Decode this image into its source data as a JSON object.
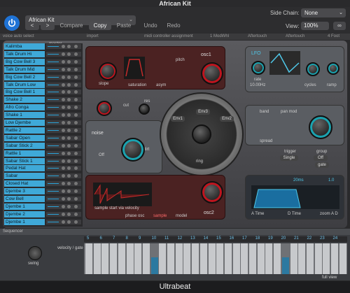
{
  "window": {
    "title": "African Kit",
    "footer": "Ultrabeat"
  },
  "header": {
    "preset": "African Kit",
    "compare": "Compare",
    "copy": "Copy",
    "paste": "Paste",
    "undo": "Undo",
    "redo": "Redo",
    "side_chain_label": "Side Chain:",
    "side_chain_value": "None",
    "view_label": "View:",
    "view_value": "100%",
    "prev": "<",
    "next": ">"
  },
  "control_strip": {
    "voice_auto_select": "voice auto select",
    "import": "import",
    "midi_controller": "midi controller assignment",
    "ctrl_a": "1 ModWhl",
    "ctrl_b": "Aftertouch",
    "ctrl_c": "Aftertouch",
    "ctrl_d": "4 Foot"
  },
  "drums": {
    "master": "master",
    "items": [
      "Kalimba",
      "Talk Drum Hi",
      "Big Cow Bell 3",
      "Talk Drum Mid",
      "Big Cow Bell 2",
      "Talk Drum Low",
      "Big Cow Bell 1",
      "Shake 2",
      "Afro Conga",
      "Shake 1",
      "Low Djembe",
      "Rattle 2",
      "Sabar Open",
      "Sabar Stick 2",
      "Rattle 1",
      "Sabar Stick 1",
      "Pedal Hat",
      "Sabar",
      "Closed Hat",
      "Djembe 3",
      "Cow Bell",
      "Djembe 1",
      "Djembe 2",
      "Djembe 1"
    ]
  },
  "synth": {
    "osc1": "osc1",
    "osc2": "osc2",
    "noise": "noise",
    "lfo": "LFO",
    "cut": "cut",
    "res": "res",
    "slope": "slope",
    "saturation": "saturation",
    "asym": "asym",
    "pitch": "pitch",
    "band_pass": "band",
    "pan_mod": "pan mod",
    "spread": "spread",
    "ring": "ring",
    "phase_osc": "phase osc",
    "sample": "sample",
    "model": "model",
    "rate": "rate",
    "rate_value": "10.00Hz",
    "cycles": "cycles",
    "ramp": "ramp",
    "off": "Off",
    "dirt": "dirt",
    "filter_labels": [
      "Env1",
      "Env2",
      "Env3"
    ],
    "trigger": "trigger",
    "trigger_value": "Single",
    "group": "group",
    "group_value": "Off",
    "gate": "gate",
    "attack": "A Time",
    "decay": "D Time",
    "zoom": "zoom A D",
    "sample_name": "sample start via velocity",
    "time_a": "20ms",
    "time_b": "1.0"
  },
  "sequencer": {
    "title": "Sequencer",
    "swing": "swing",
    "velocity_gate": "velocity / gate",
    "step_on": [
      false,
      false,
      false,
      false,
      false,
      false,
      false,
      false,
      true,
      false,
      false,
      false,
      false,
      false,
      false,
      false,
      false,
      false,
      false,
      false,
      false,
      false,
      false,
      false,
      true,
      false,
      false,
      false,
      false,
      false,
      false,
      false
    ],
    "step_labels": [
      "5",
      "6",
      "7",
      "8",
      "9",
      "10",
      "11",
      "12",
      "13",
      "14",
      "15",
      "16",
      "17",
      "18",
      "19",
      "20",
      "21",
      "22",
      "23",
      "24"
    ],
    "bottom_left": "full view"
  },
  "colors": {
    "accent": "#1f73d6",
    "drum_highlight": "#3fa9d8",
    "step_on": "#2c79a0"
  }
}
